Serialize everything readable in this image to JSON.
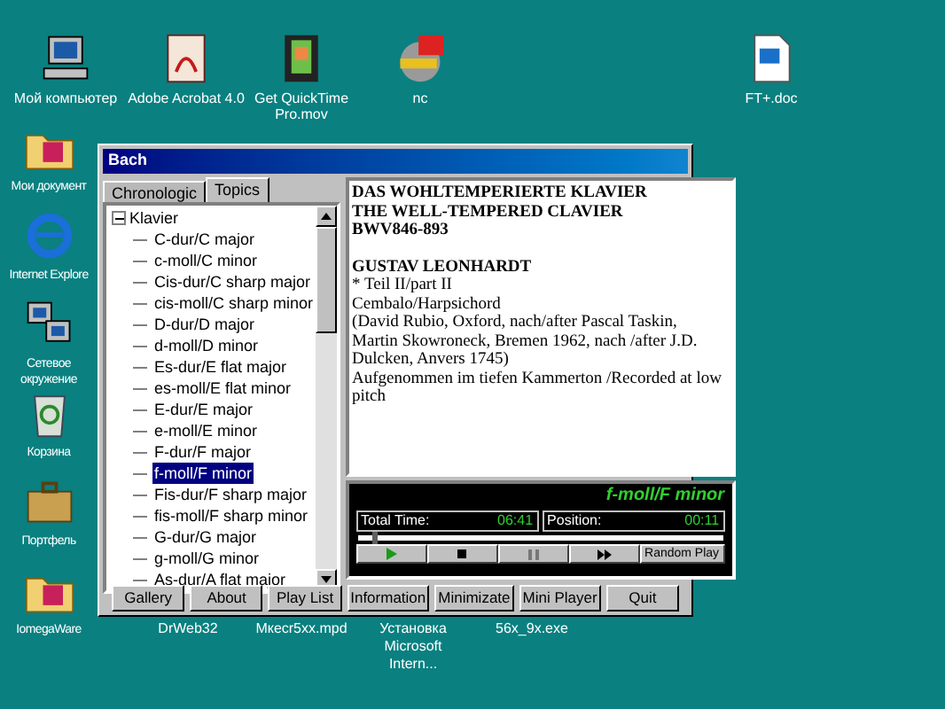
{
  "desktop": {
    "icons": [
      {
        "label": "Мой компьютер",
        "kind": "computer"
      },
      {
        "label": "Adobe Acrobat 4.0",
        "kind": "pdf"
      },
      {
        "label": "Get QuickTime Pro.mov",
        "kind": "movie"
      },
      {
        "label": "nc",
        "kind": "app"
      },
      {
        "label": "FT+.doc",
        "kind": "doc"
      },
      {
        "label": "Мои документ",
        "kind": "folder"
      },
      {
        "label": "Internet Explore",
        "kind": "browser"
      },
      {
        "label": "Сетевое окружение",
        "kind": "network"
      },
      {
        "label": "Корзина",
        "kind": "trash"
      },
      {
        "label": "Портфель",
        "kind": "briefcase"
      },
      {
        "label": "IomegaWare",
        "kind": "folder"
      }
    ],
    "labels_below_window": [
      "DrWeb32",
      "Мкесr5хх.mpd",
      "Установка Microsoft Intern...",
      "56x_9x.exe"
    ]
  },
  "window": {
    "title": "Bach",
    "tabs": [
      {
        "label": "Chronologic",
        "selected": false
      },
      {
        "label": "Topics",
        "selected": true
      }
    ],
    "tree": {
      "label": "Klavier",
      "expanded": true,
      "children": [
        {
          "label": "C-dur/C major",
          "selected": false
        },
        {
          "label": "c-moll/C minor",
          "selected": false
        },
        {
          "label": "Cis-dur/C sharp major",
          "selected": false
        },
        {
          "label": "cis-moll/C sharp minor",
          "selected": false
        },
        {
          "label": "D-dur/D major",
          "selected": false
        },
        {
          "label": "d-moll/D minor",
          "selected": false
        },
        {
          "label": "Es-dur/E flat major",
          "selected": false
        },
        {
          "label": "es-moll/E flat minor",
          "selected": false
        },
        {
          "label": "E-dur/E major",
          "selected": false
        },
        {
          "label": "e-moll/E minor",
          "selected": false
        },
        {
          "label": "F-dur/F major",
          "selected": false
        },
        {
          "label": "f-moll/F minor",
          "selected": true
        },
        {
          "label": "Fis-dur/F sharp major",
          "selected": false
        },
        {
          "label": "fis-moll/F sharp minor",
          "selected": false
        },
        {
          "label": "G-dur/G major",
          "selected": false
        },
        {
          "label": "g-moll/G minor",
          "selected": false
        },
        {
          "label": "As-dur/A flat major",
          "selected": false
        }
      ]
    },
    "info": {
      "header": [
        "DAS WOHLTEMPERIERTE KLAVIER",
        "THE WELL-TEMPERED CLAVIER",
        "BWV846-893"
      ],
      "details": [
        {
          "text": "GUSTAV LEONHARDT",
          "bold": true
        },
        {
          "text": "* Teil II/part II",
          "bold": false
        },
        {
          "text": "Cembalo/Harpsichord",
          "bold": false
        },
        {
          "text": "(David Rubio, Oxford, nach/after Pascal Taskin,",
          "bold": false
        },
        {
          "text": "Martin Skowroneck, Bremen 1962, nach /after J.D. Dulcken, Anvers 1745)",
          "bold": false
        },
        {
          "text": "Aufgenommen im tiefen Kammerton /Recorded at low pitch",
          "bold": false
        }
      ]
    },
    "player": {
      "track": "f-moll/F minor",
      "total_label": "Total Time:",
      "total": "06:41",
      "position_label": "Position:",
      "position": "00:11",
      "level": 0.04,
      "controls": [
        {
          "kind": "play"
        },
        {
          "kind": "stop"
        },
        {
          "kind": "pause"
        },
        {
          "kind": "forward"
        },
        {
          "kind": "text",
          "label": "Random Play"
        }
      ]
    },
    "buttons": [
      "Gallery",
      "About",
      "Play List",
      "Information",
      "Minimizate",
      "Mini Player",
      "Quit"
    ]
  }
}
